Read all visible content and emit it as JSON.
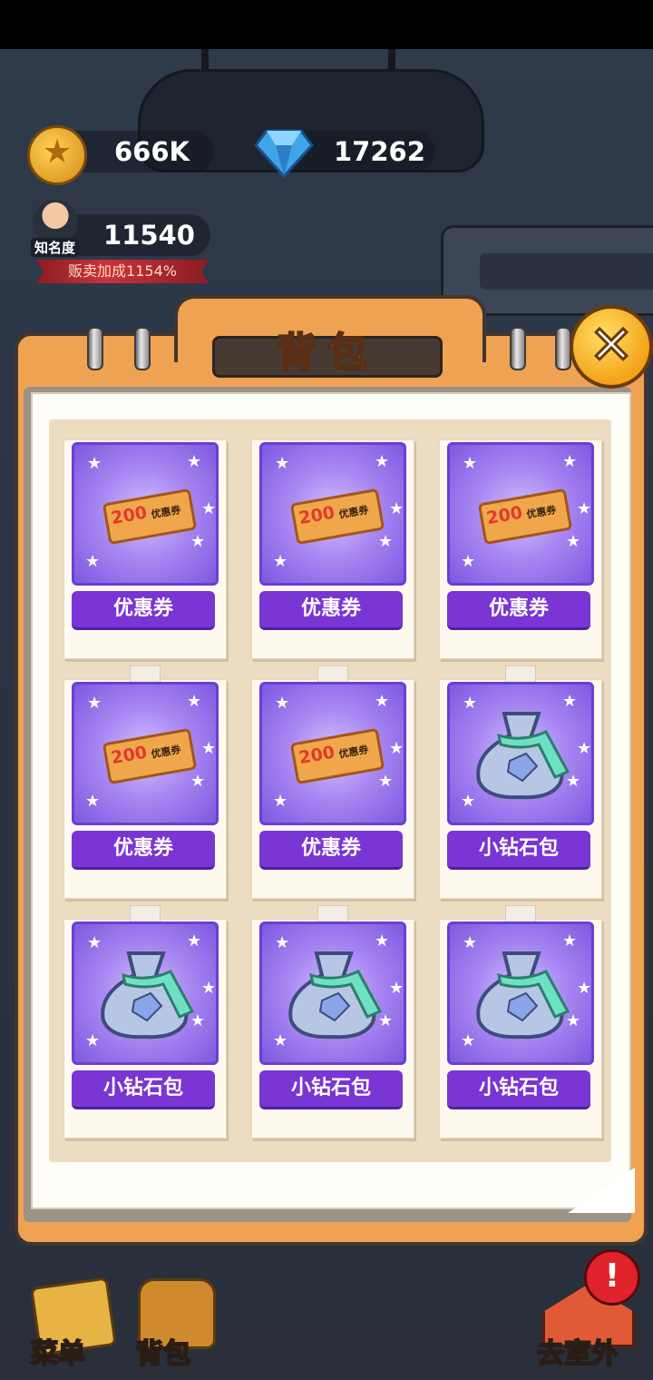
{
  "currency": {
    "coins": "666K",
    "gems": "17262"
  },
  "fame": {
    "label": "知名度",
    "value": "11540",
    "bonus_text": "贩卖加成1154%"
  },
  "panel": {
    "title": "背包",
    "close_symbol": "✕"
  },
  "items": [
    {
      "name": "优惠券",
      "icon": "coupon-icon",
      "ticket_value": "200",
      "ticket_text": "优惠券"
    },
    {
      "name": "优惠券",
      "icon": "coupon-icon",
      "ticket_value": "200",
      "ticket_text": "优惠券"
    },
    {
      "name": "优惠券",
      "icon": "coupon-icon",
      "ticket_value": "200",
      "ticket_text": "优惠券"
    },
    {
      "name": "优惠券",
      "icon": "coupon-icon",
      "ticket_value": "200",
      "ticket_text": "优惠券"
    },
    {
      "name": "优惠券",
      "icon": "coupon-icon",
      "ticket_value": "200",
      "ticket_text": "优惠券"
    },
    {
      "name": "小钻石包",
      "icon": "diamond-bag-icon"
    },
    {
      "name": "小钻石包",
      "icon": "diamond-bag-icon"
    },
    {
      "name": "小钻石包",
      "icon": "diamond-bag-icon"
    },
    {
      "name": "小钻石包",
      "icon": "diamond-bag-icon"
    }
  ],
  "bottom_nav": {
    "menu": "菜单",
    "backpack": "背包",
    "go_outside": "去室外",
    "alert_symbol": "!"
  },
  "colors": {
    "item_tile": "#8a62e6",
    "item_label_bg": "#7a35d4",
    "panel_orange": "#f0a253",
    "close_button": "#f4a21a"
  }
}
